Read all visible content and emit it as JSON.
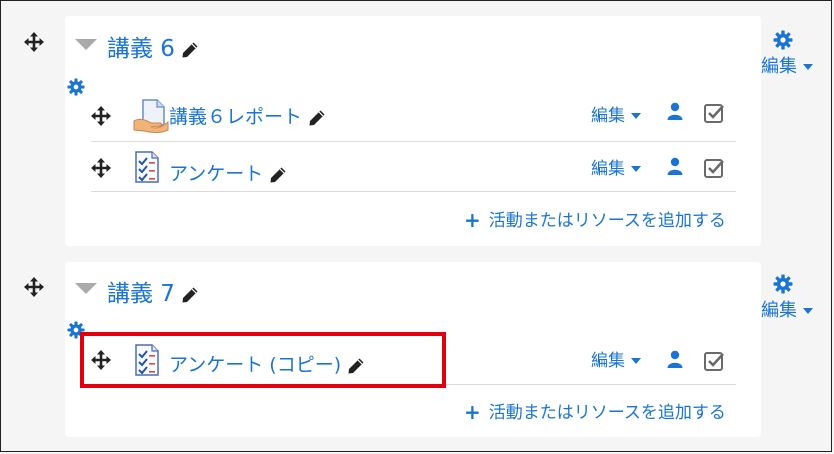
{
  "sections": [
    {
      "title": "講義 6",
      "edit_label": "編集",
      "activities": [
        {
          "name": "講義６レポート",
          "icon": "assignment-icon",
          "edit_label": "編集"
        },
        {
          "name": "アンケート",
          "icon": "feedback-icon",
          "edit_label": "編集"
        }
      ],
      "add_label": "活動またはリソースを追加する"
    },
    {
      "title": "講義 7",
      "edit_label": "編集",
      "activities": [
        {
          "name": "アンケート (コピー)",
          "icon": "feedback-icon",
          "edit_label": "編集",
          "highlighted": true
        }
      ],
      "add_label": "活動またはリソースを追加する"
    }
  ],
  "colors": {
    "link": "#1b74d3",
    "highlight": "#e0000e",
    "panel": "#ffffff",
    "background": "#f5f5f5"
  }
}
